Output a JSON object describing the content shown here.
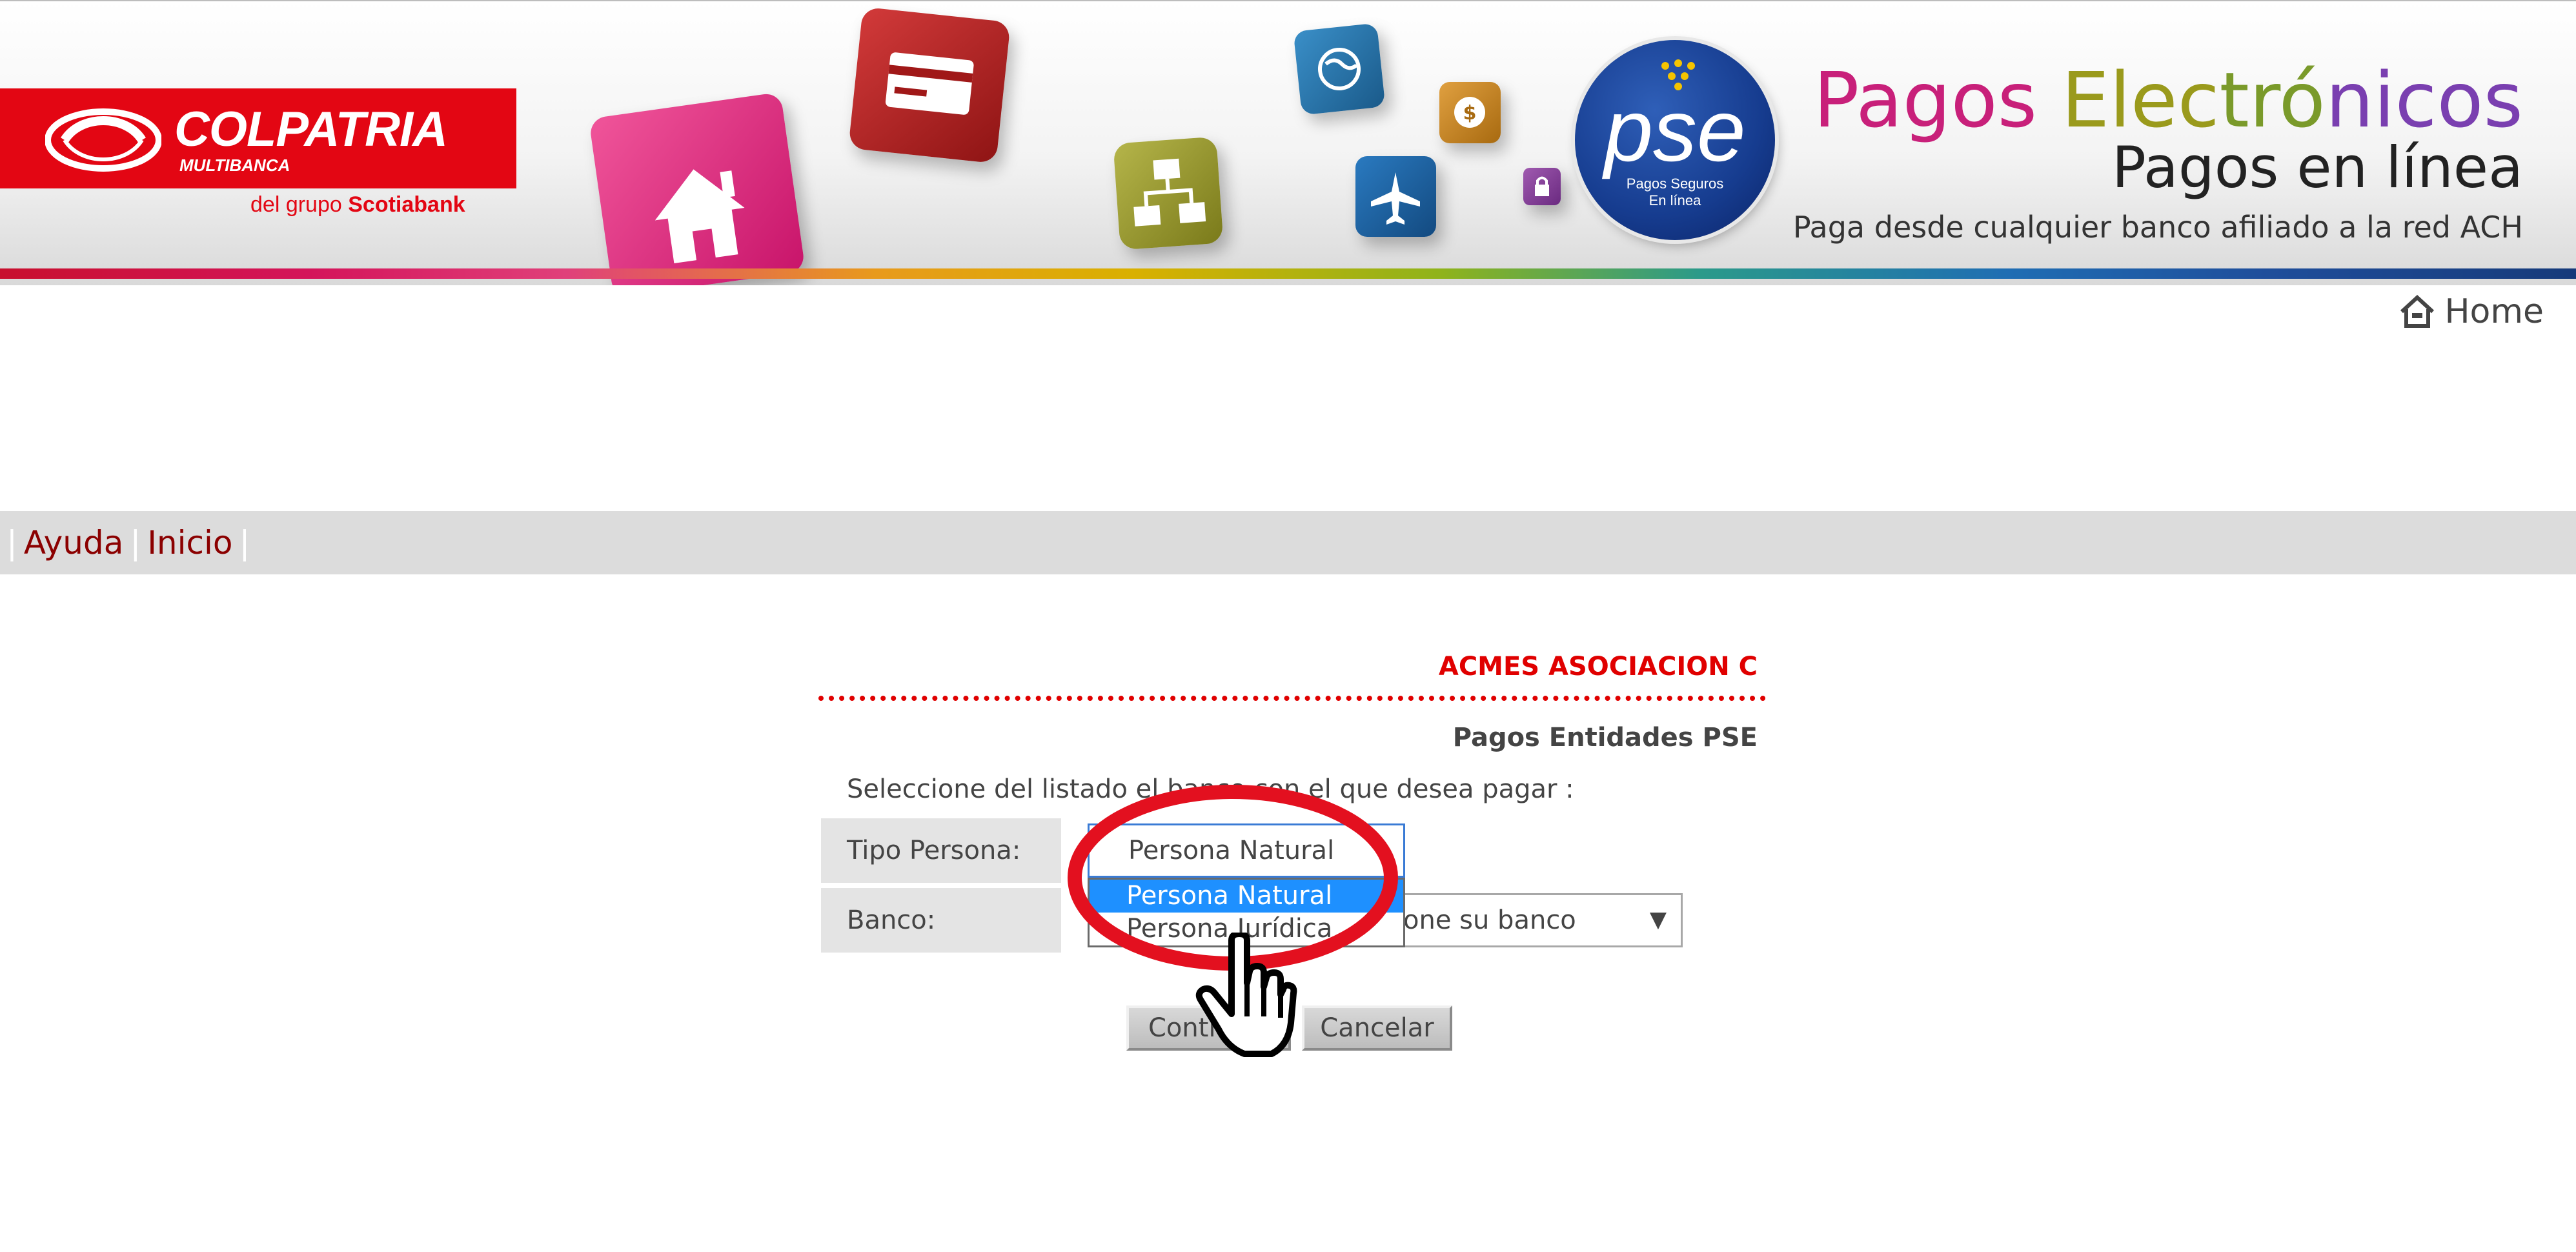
{
  "header": {
    "logo": {
      "name": "COLPATRIA",
      "subtitle": "MULTIBANCA",
      "group_prefix": "del grupo",
      "group_name": "Scotiabank"
    },
    "pse_logo": {
      "text": "pse",
      "sub_line1": "Pagos Seguros",
      "sub_line2": "En línea"
    },
    "title_parts": [
      {
        "text": "Pagos ",
        "color": "#c8207a"
      },
      {
        "text": "Elec",
        "color": "#9a9a1c"
      },
      {
        "text": "tró",
        "color": "#7a9a2a"
      },
      {
        "text": "nicos",
        "color": "#7a3fb0"
      }
    ],
    "subtitle": "Pagos en línea",
    "tagline": "Paga desde cualquier banco afiliado a la red ACH",
    "icons": [
      "home-cube-icon",
      "credit-card-cube-icon",
      "network-cube-icon",
      "globe-cube-icon",
      "money-cube-icon",
      "airplane-cube-icon",
      "lock-cube-icon"
    ]
  },
  "nav": {
    "home_label": "Home",
    "home_icon": "home-icon"
  },
  "menu": {
    "items": [
      {
        "label": "Ayuda"
      },
      {
        "label": "Inicio"
      }
    ],
    "separator": "|"
  },
  "form": {
    "merchant": "ACMES ASOCIACION C",
    "section_title": "Pagos Entidades  PSE",
    "instruction": "Seleccione del listado el banco con el que desea pagar :",
    "tipo_persona": {
      "label": "Tipo Persona:",
      "value": "Persona Natural",
      "options": [
        "Persona Natural",
        "Persona Jurídica"
      ]
    },
    "banco": {
      "label": "Banco:",
      "visible_text": "one su banco",
      "arrow": "▼"
    },
    "buttons": {
      "continue_label": "Conti",
      "cancel_label": "Cancelar"
    }
  },
  "colors": {
    "brand_red": "#e30613",
    "menu_link": "#8b0000",
    "merchant_red": "#e00000",
    "selected_option": "#1e90ff",
    "annotation_red": "#e3101f"
  }
}
